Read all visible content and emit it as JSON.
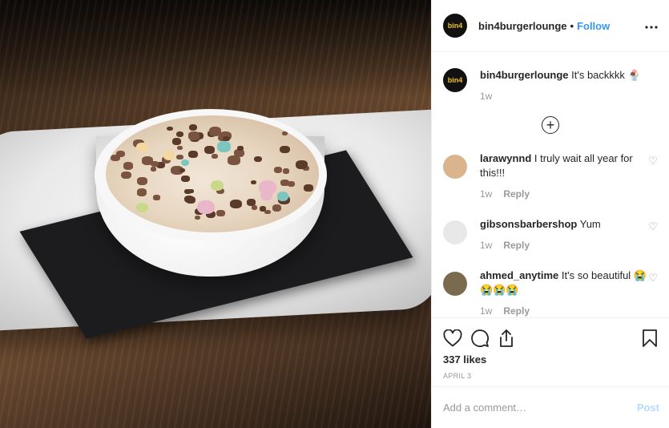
{
  "post": {
    "author": "bin4burgerlounge",
    "follow_label": "Follow",
    "separator": "•",
    "more_icon": "more-horizontal-icon",
    "logo_text": "bin4"
  },
  "caption": {
    "username": "bin4burgerlounge",
    "text": "It's backkkk 🍨",
    "time": "1w"
  },
  "load_more_icon": "plus-circle-icon",
  "comments": [
    {
      "username": "larawynnd",
      "text": "I truly wait all year for this!!!",
      "time": "1w",
      "reply": "Reply",
      "avatar_color": "#d9b48f"
    },
    {
      "username": "gibsonsbarbershop",
      "text": "Yum",
      "time": "1w",
      "reply": "Reply",
      "avatar_color": "#e8e8e8"
    },
    {
      "username": "ahmed_anytime",
      "text": "It's so beautiful 😭😭😭😭",
      "time": "1w",
      "reply": "Reply",
      "avatar_color": "#7a6a4e"
    }
  ],
  "actions": {
    "likes": "337 likes",
    "date": "APRIL 3",
    "icons": [
      "heart-icon",
      "comment-icon",
      "share-icon",
      "bookmark-icon"
    ]
  },
  "add_comment": {
    "placeholder": "Add a comment…",
    "post_label": "Post"
  },
  "colors": {
    "link": "#3897f0",
    "muted": "#999999",
    "post_disabled": "#b3dbff"
  }
}
